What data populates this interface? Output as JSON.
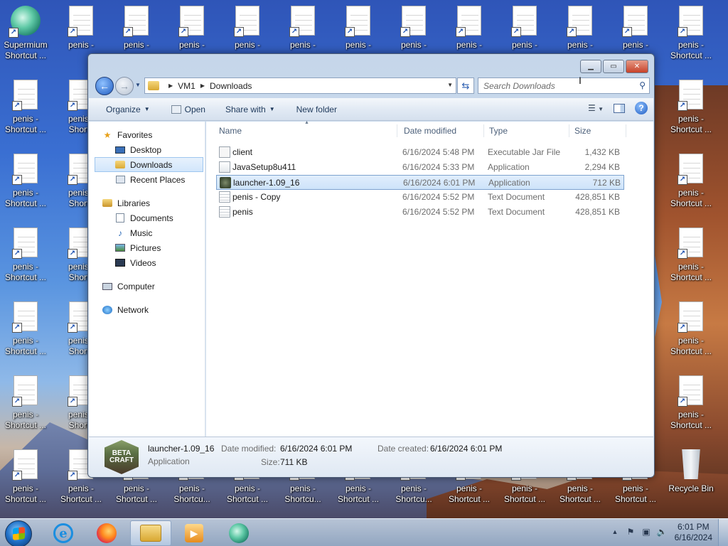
{
  "desktop": {
    "supermium": {
      "label": "Supermium\nShortcut ..."
    },
    "shortcut_label": "penis -\nShortcut ...",
    "shortcut_label_cut": "penis -\nShortcu...",
    "shortcut_label_top": "penis -",
    "shortcut_label_left": "penis -\nShortc",
    "recycle": {
      "label": "Recycle Bin"
    }
  },
  "window": {
    "address": {
      "crumbs": [
        "VM1",
        "Downloads"
      ]
    },
    "search": {
      "placeholder": "Search Downloads"
    },
    "toolbar": {
      "organize": "Organize",
      "open": "Open",
      "share_with": "Share with",
      "new_folder": "New folder"
    },
    "nav": {
      "favorites": "Favorites",
      "desktop": "Desktop",
      "downloads": "Downloads",
      "recent_places": "Recent Places",
      "libraries": "Libraries",
      "documents": "Documents",
      "music": "Music",
      "pictures": "Pictures",
      "videos": "Videos",
      "computer": "Computer",
      "network": "Network"
    },
    "columns": {
      "name": "Name",
      "date": "Date modified",
      "type": "Type",
      "size": "Size"
    },
    "files": [
      {
        "name": "client",
        "date": "6/16/2024 5:48 PM",
        "type": "Executable Jar File",
        "size": "1,432 KB",
        "icon": "jar-icon"
      },
      {
        "name": "JavaSetup8u411",
        "date": "6/16/2024 5:33 PM",
        "type": "Application",
        "size": "2,294 KB",
        "icon": "java-setup-icon"
      },
      {
        "name": "launcher-1.09_16",
        "date": "6/16/2024 6:01 PM",
        "type": "Application",
        "size": "712 KB",
        "icon": "launcher-icon"
      },
      {
        "name": "penis - Copy",
        "date": "6/16/2024 5:52 PM",
        "type": "Text Document",
        "size": "428,851 KB",
        "icon": "text-file-icon"
      },
      {
        "name": "penis",
        "date": "6/16/2024 5:52 PM",
        "type": "Text Document",
        "size": "428,851 KB",
        "icon": "text-file-icon"
      }
    ],
    "details": {
      "thumb_text": "BETA CRAFT",
      "name": "launcher-1.09_16",
      "type": "Application",
      "date_modified_label": "Date modified:",
      "date_modified": "6/16/2024 6:01 PM",
      "date_created_label": "Date created:",
      "date_created": "6/16/2024 6:01 PM",
      "size_label": "Size:",
      "size": "711 KB"
    }
  },
  "taskbar": {
    "clock": {
      "time": "6:01 PM",
      "date": "6/16/2024"
    }
  }
}
